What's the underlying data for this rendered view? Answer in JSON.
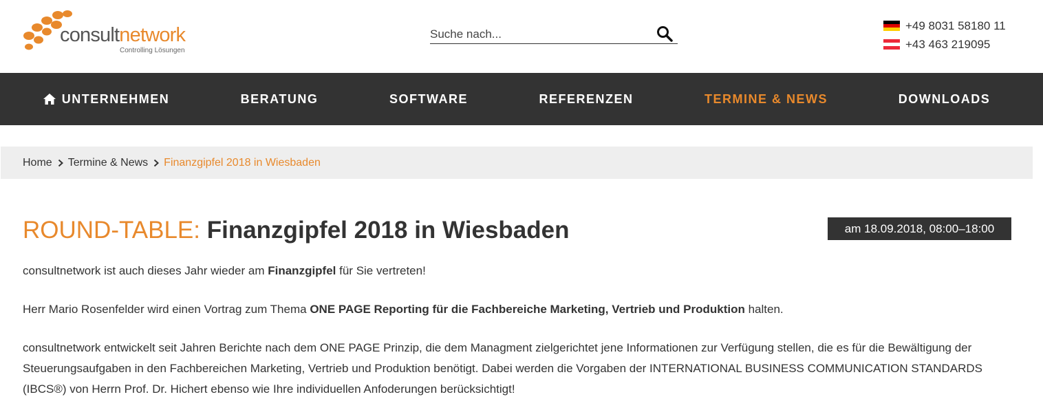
{
  "header": {
    "logo": {
      "word_part1": "consult",
      "word_part2": "network",
      "tagline": "Controlling Lösungen",
      "dot_color": "#e8892c"
    },
    "search": {
      "placeholder": "Suche nach...",
      "icon": "search-icon"
    },
    "phones": [
      {
        "country": "de",
        "flag_icon": "flag-germany-icon",
        "number": "+49 8031 58180 11"
      },
      {
        "country": "at",
        "flag_icon": "flag-austria-icon",
        "number": "+43 463 219095"
      }
    ]
  },
  "nav": {
    "background": "#333333",
    "active_color": "#e8892c",
    "items": [
      {
        "label": "UNTERNEHMEN",
        "icon": "home-icon"
      },
      {
        "label": "BERATUNG"
      },
      {
        "label": "SOFTWARE"
      },
      {
        "label": "REFERENZEN"
      },
      {
        "label": "TERMINE & NEWS",
        "active": true
      },
      {
        "label": "DOWNLOADS"
      }
    ]
  },
  "breadcrumb": {
    "items": [
      "Home",
      "Termine & News"
    ],
    "current": "Finanzgipfel 2018 in Wiesbaden"
  },
  "article": {
    "title_prefix": "ROUND-TABLE:",
    "title": "Finanzgipfel 2018 in Wiesbaden",
    "date": "am 18.09.2018, 08:00–18:00",
    "p1": {
      "before": "consultnetwork ist auch dieses Jahr wieder am ",
      "bold": "Finanzgipfel",
      "after": " für Sie vertreten!"
    },
    "p2": {
      "before": "Herr Mario Rosenfelder wird einen Vortrag zum Thema ",
      "bold": "ONE PAGE Reporting für die Fachbereiche Marketing, Vertrieb und Produktion",
      "after": " halten."
    },
    "p3": "consultnetwork entwickelt seit Jahren Berichte nach dem ONE PAGE Prinzip, die dem Managment zielgerichtet jene Informationen zur Verfügung stellen, die es für die Bewältigung der Steuerungsaufgaben in den Fachbereichen Marketing, Vertrieb und Produktion benötigt. Dabei werden die Vorgaben der INTERNATIONAL BUSINESS COMMUNICATION STANDARDS (IBCS®) von Herrn Prof. Dr. Hichert ebenso wie Ihre individuellen Anfoderungen berücksichtigt!"
  }
}
